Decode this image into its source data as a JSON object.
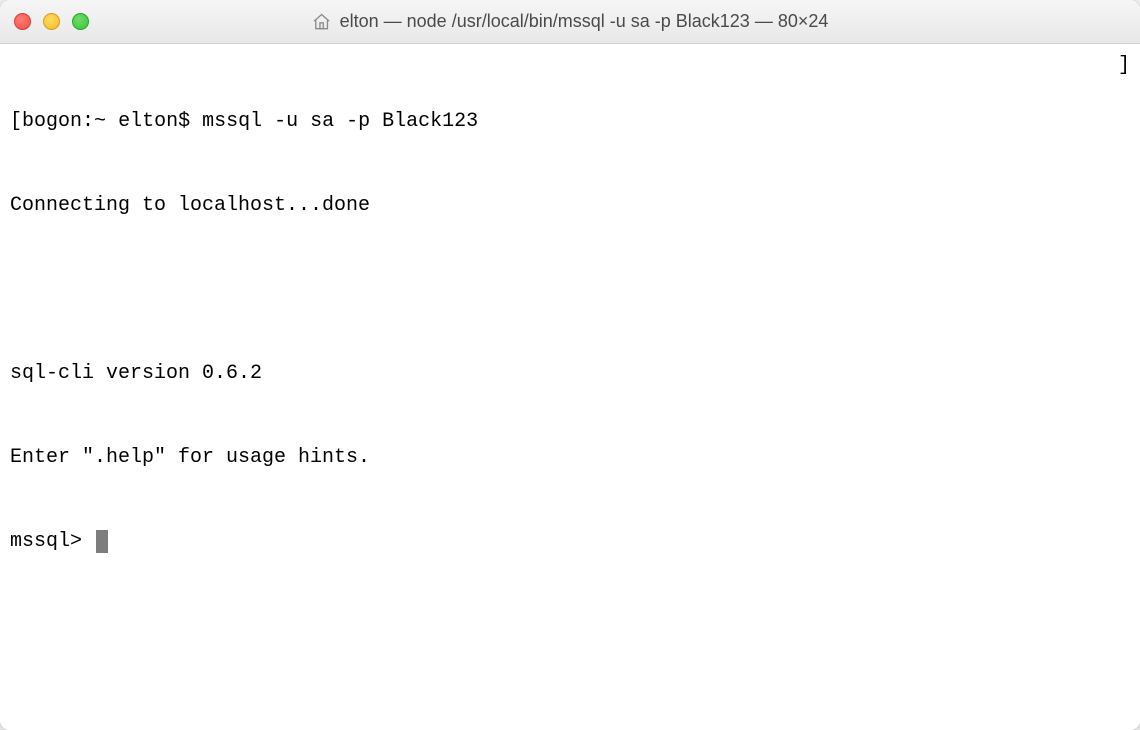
{
  "titleBar": {
    "title": "elton — node /usr/local/bin/mssql -u sa -p Black123 — 80×24",
    "icons": {
      "home": "home-icon"
    }
  },
  "terminal": {
    "promptLine": {
      "leftBracket": "[",
      "host": "bogon",
      "path": "~",
      "user": "elton",
      "promptChar": "$",
      "command": "mssql -u sa -p Black123",
      "rightBracket": "]"
    },
    "lines": [
      "Connecting to localhost...done",
      "",
      "sql-cli version 0.6.2",
      "Enter \".help\" for usage hints."
    ],
    "activePrompt": "mssql>"
  }
}
